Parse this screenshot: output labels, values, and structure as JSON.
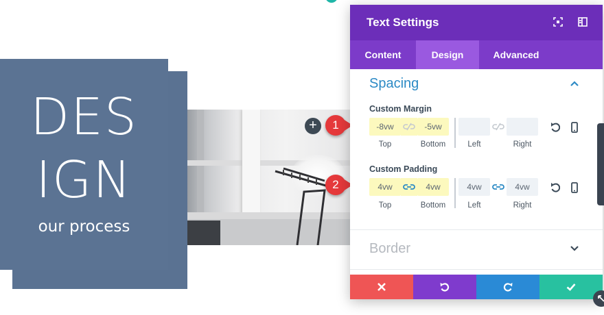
{
  "canvas": {
    "heading_line1": "DES",
    "heading_line2": "IGN",
    "subheading": "our process",
    "add_button_label": "+",
    "marker_1": "1",
    "marker_2": "2"
  },
  "modal": {
    "title": "Text Settings",
    "tabs": [
      {
        "label": "Content",
        "active": false
      },
      {
        "label": "Design",
        "active": true
      },
      {
        "label": "Advanced",
        "active": false
      }
    ],
    "spacing": {
      "title": "Spacing",
      "expanded": true,
      "custom_margin": {
        "label": "Custom Margin",
        "top": "-8vw",
        "bottom": "-5vw",
        "left": "",
        "right": "",
        "top_label": "Top",
        "bottom_label": "Bottom",
        "left_label": "Left",
        "right_label": "Right",
        "top_bottom_linked": false,
        "left_right_linked": false
      },
      "custom_padding": {
        "label": "Custom Padding",
        "top": "4vw",
        "bottom": "4vw",
        "left": "4vw",
        "right": "4vw",
        "top_label": "Top",
        "bottom_label": "Bottom",
        "left_label": "Left",
        "right_label": "Right",
        "top_bottom_linked": true,
        "left_right_linked": true
      }
    },
    "border": {
      "title": "Border",
      "expanded": false
    },
    "footer": {
      "cancel_icon": "close-icon",
      "undo_icon": "undo-icon",
      "redo_icon": "redo-icon",
      "save_icon": "check-icon"
    },
    "colors": {
      "header": "#6c2eb9",
      "tabs": "#7c3bc9",
      "active_tab": "#9a59e0",
      "section_title": "#2c8ac5",
      "highlight": "#fcf9be",
      "cancel": "#ef5555",
      "undo": "#7f3bcd",
      "redo": "#2a8ad6",
      "save": "#28c1a0",
      "marker": "#e5393b"
    }
  }
}
